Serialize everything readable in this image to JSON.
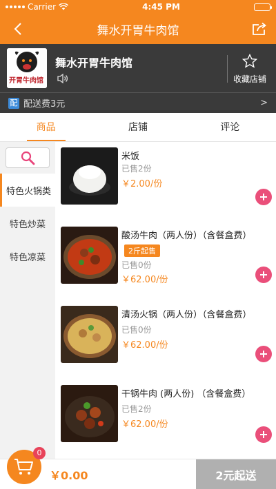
{
  "status_bar": {
    "carrier": "Carrier",
    "time": "4:45 PM"
  },
  "nav": {
    "title": "舞水开胃牛肉馆"
  },
  "shop": {
    "name": "舞水开胃牛肉馆",
    "logo_text": "开胃牛肉馆",
    "favorite_label": "收藏店铺",
    "delivery_badge": "配",
    "delivery_fee": "配送费3元",
    "delivery_arrow": ">"
  },
  "tabs": [
    {
      "label": "商品",
      "active": true
    },
    {
      "label": "店铺",
      "active": false
    },
    {
      "label": "评论",
      "active": false
    }
  ],
  "categories": [
    {
      "label": "特色火锅类",
      "active": true
    },
    {
      "label": "特色炒菜",
      "active": false
    },
    {
      "label": "特色凉菜",
      "active": false
    }
  ],
  "products": [
    {
      "name": "米饭",
      "sold": "已售2份",
      "price": "￥2.00/份",
      "badge": ""
    },
    {
      "name": "酸汤牛肉（两人份）（含餐盒费）",
      "sold": "已售0份",
      "price": "￥62.00/份",
      "badge": "2斤起售"
    },
    {
      "name": "清汤火锅（两人份）（含餐盒费）",
      "sold": "已售0份",
      "price": "￥62.00/份",
      "badge": ""
    },
    {
      "name": "干锅牛肉 (两人份) （含餐盒费）",
      "sold": "已售2份",
      "price": "￥62.00/份",
      "badge": ""
    }
  ],
  "cart": {
    "count": "0",
    "total": "￥0.00",
    "checkout_label": "2元起送"
  },
  "colors": {
    "accent": "#f5871f",
    "header_dark": "#3a3a3a",
    "add_button": "#ea4f7a",
    "disabled": "#b0b0b0"
  }
}
